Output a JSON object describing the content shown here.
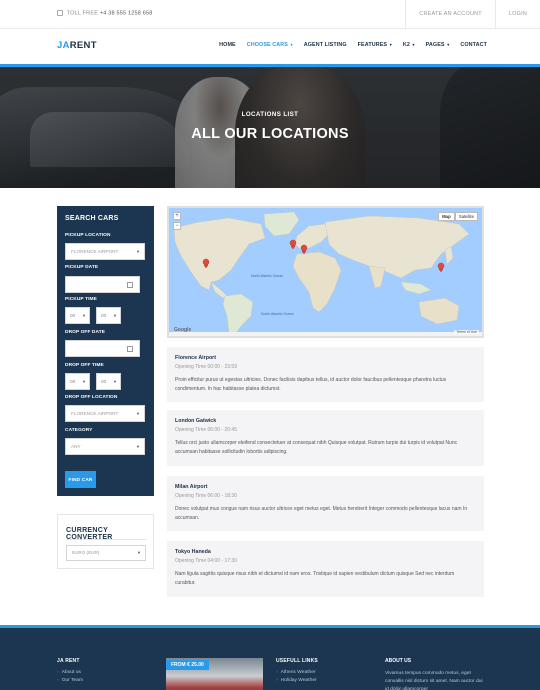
{
  "topbar": {
    "phone_label": "TOLL FREE",
    "phone_number": "+4 38 555 1258 658",
    "links": [
      "CREATE AN ACCOUNT",
      "LOGIN"
    ]
  },
  "header": {
    "logo_ja": "JA",
    "logo_rest": "RENT",
    "nav": [
      {
        "label": "HOME"
      },
      {
        "label": "CHOOSE CARS",
        "caret": "▾"
      },
      {
        "label": "AGENT LISTING"
      },
      {
        "label": "FEATURES",
        "caret": "▾"
      },
      {
        "label": "K2",
        "caret": "▾"
      },
      {
        "label": "PAGES",
        "caret": "▾"
      },
      {
        "label": "CONTACT"
      }
    ]
  },
  "hero": {
    "kicker": "LOCATIONS LIST",
    "title": "ALL OUR LOCATIONS"
  },
  "search": {
    "title": "SEARCH CARS",
    "pickup_location_label": "PICKUP LOCATION",
    "pickup_location_value": "FLORENCE AIRPORT",
    "pickup_date_label": "PICKUP DATE",
    "pickup_time_label": "PICKUP TIME",
    "pickup_hour": "00",
    "pickup_min": "00",
    "dropoff_date_label": "DROP OFF DATE",
    "dropoff_time_label": "DROP OFF TIME",
    "dropoff_hour": "00",
    "dropoff_min": "00",
    "dropoff_location_label": "DROP OFF LOCATION",
    "dropoff_location_value": "FLORENCE AIRPORT",
    "category_label": "CATEGORY",
    "category_value": "ANY",
    "find_button": "FIND CAR"
  },
  "currency": {
    "title": "CURRENCY CONVERTER",
    "selected": "EURO (EUR)"
  },
  "map": {
    "zoom_in": "+",
    "zoom_out": "−",
    "type_map": "Map",
    "type_satellite": "Satellite",
    "google": "Google",
    "terms": "Terms of Use",
    "north_atlantic": "North Atlantic Ocean",
    "south_atlantic": "South Atlantic Ocean"
  },
  "locations": [
    {
      "name": "Florence Airport",
      "hours": "Opening Time 00:00 - 23:59",
      "desc": "Proin efficitur purus ut egestas ultricies. Donec facilisis dapibus tellus, id auctor dolor faucibus pellentesque pharetra luctus condimentum. In hac habitasse platea dictumst."
    },
    {
      "name": "London Gatwick",
      "hours": "Opening Time 06:00 - 20:45",
      "desc": "Tellus orci justo ullamcorper eleifend consectetuer at consequat nibh Quisque volutpat. Rutrum turpis dui turpis id volutpat Nunc accumsan habitasse sollicitudin lobortis adipiscing."
    },
    {
      "name": "Milan Airport",
      "hours": "Opening Time 06:00 - 18:30",
      "desc": "Donec volutpat mus congue nam risus auctor ultrices eget metus eget. Metus hendrerit Integer commodo pellentesque lacus nam In accumsan."
    },
    {
      "name": "Tokyo Haneda",
      "hours": "Opening Time 04:00 - 17:30",
      "desc": "Nam ligula sagittis quisque risus nibh et dictumst id nam eros. Tristique id sapien vestibulum dictum quisque Sed nec interdum curabitur."
    }
  ],
  "footer": {
    "col1_title": "JA RENT",
    "col1_items": [
      "About us",
      "Our Team"
    ],
    "promo_price": "FROM € 25.00",
    "col3_title": "USEFULL LINKS",
    "col3_items": [
      "Athens Weather",
      "Holiday Weather"
    ],
    "about_title": "ABOUT US",
    "about_text": "Vivamus tempus commodo metus, eget convallis nisl dictum sit amet. Nam auctor dui id dolor ullamcorper"
  },
  "colors": {
    "accent": "#2a9ae8",
    "navy": "#1c3651"
  }
}
